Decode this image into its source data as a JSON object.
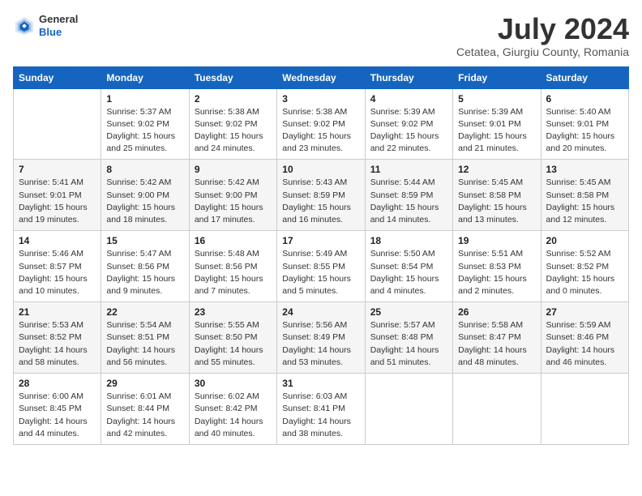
{
  "header": {
    "logo_general": "General",
    "logo_blue": "Blue",
    "month_year": "July 2024",
    "location": "Cetatea, Giurgiu County, Romania"
  },
  "calendar": {
    "weekdays": [
      "Sunday",
      "Monday",
      "Tuesday",
      "Wednesday",
      "Thursday",
      "Friday",
      "Saturday"
    ],
    "weeks": [
      [
        {
          "day": "",
          "info": ""
        },
        {
          "day": "1",
          "info": "Sunrise: 5:37 AM\nSunset: 9:02 PM\nDaylight: 15 hours\nand 25 minutes."
        },
        {
          "day": "2",
          "info": "Sunrise: 5:38 AM\nSunset: 9:02 PM\nDaylight: 15 hours\nand 24 minutes."
        },
        {
          "day": "3",
          "info": "Sunrise: 5:38 AM\nSunset: 9:02 PM\nDaylight: 15 hours\nand 23 minutes."
        },
        {
          "day": "4",
          "info": "Sunrise: 5:39 AM\nSunset: 9:02 PM\nDaylight: 15 hours\nand 22 minutes."
        },
        {
          "day": "5",
          "info": "Sunrise: 5:39 AM\nSunset: 9:01 PM\nDaylight: 15 hours\nand 21 minutes."
        },
        {
          "day": "6",
          "info": "Sunrise: 5:40 AM\nSunset: 9:01 PM\nDaylight: 15 hours\nand 20 minutes."
        }
      ],
      [
        {
          "day": "7",
          "info": "Sunrise: 5:41 AM\nSunset: 9:01 PM\nDaylight: 15 hours\nand 19 minutes."
        },
        {
          "day": "8",
          "info": "Sunrise: 5:42 AM\nSunset: 9:00 PM\nDaylight: 15 hours\nand 18 minutes."
        },
        {
          "day": "9",
          "info": "Sunrise: 5:42 AM\nSunset: 9:00 PM\nDaylight: 15 hours\nand 17 minutes."
        },
        {
          "day": "10",
          "info": "Sunrise: 5:43 AM\nSunset: 8:59 PM\nDaylight: 15 hours\nand 16 minutes."
        },
        {
          "day": "11",
          "info": "Sunrise: 5:44 AM\nSunset: 8:59 PM\nDaylight: 15 hours\nand 14 minutes."
        },
        {
          "day": "12",
          "info": "Sunrise: 5:45 AM\nSunset: 8:58 PM\nDaylight: 15 hours\nand 13 minutes."
        },
        {
          "day": "13",
          "info": "Sunrise: 5:45 AM\nSunset: 8:58 PM\nDaylight: 15 hours\nand 12 minutes."
        }
      ],
      [
        {
          "day": "14",
          "info": "Sunrise: 5:46 AM\nSunset: 8:57 PM\nDaylight: 15 hours\nand 10 minutes."
        },
        {
          "day": "15",
          "info": "Sunrise: 5:47 AM\nSunset: 8:56 PM\nDaylight: 15 hours\nand 9 minutes."
        },
        {
          "day": "16",
          "info": "Sunrise: 5:48 AM\nSunset: 8:56 PM\nDaylight: 15 hours\nand 7 minutes."
        },
        {
          "day": "17",
          "info": "Sunrise: 5:49 AM\nSunset: 8:55 PM\nDaylight: 15 hours\nand 5 minutes."
        },
        {
          "day": "18",
          "info": "Sunrise: 5:50 AM\nSunset: 8:54 PM\nDaylight: 15 hours\nand 4 minutes."
        },
        {
          "day": "19",
          "info": "Sunrise: 5:51 AM\nSunset: 8:53 PM\nDaylight: 15 hours\nand 2 minutes."
        },
        {
          "day": "20",
          "info": "Sunrise: 5:52 AM\nSunset: 8:52 PM\nDaylight: 15 hours\nand 0 minutes."
        }
      ],
      [
        {
          "day": "21",
          "info": "Sunrise: 5:53 AM\nSunset: 8:52 PM\nDaylight: 14 hours\nand 58 minutes."
        },
        {
          "day": "22",
          "info": "Sunrise: 5:54 AM\nSunset: 8:51 PM\nDaylight: 14 hours\nand 56 minutes."
        },
        {
          "day": "23",
          "info": "Sunrise: 5:55 AM\nSunset: 8:50 PM\nDaylight: 14 hours\nand 55 minutes."
        },
        {
          "day": "24",
          "info": "Sunrise: 5:56 AM\nSunset: 8:49 PM\nDaylight: 14 hours\nand 53 minutes."
        },
        {
          "day": "25",
          "info": "Sunrise: 5:57 AM\nSunset: 8:48 PM\nDaylight: 14 hours\nand 51 minutes."
        },
        {
          "day": "26",
          "info": "Sunrise: 5:58 AM\nSunset: 8:47 PM\nDaylight: 14 hours\nand 48 minutes."
        },
        {
          "day": "27",
          "info": "Sunrise: 5:59 AM\nSunset: 8:46 PM\nDaylight: 14 hours\nand 46 minutes."
        }
      ],
      [
        {
          "day": "28",
          "info": "Sunrise: 6:00 AM\nSunset: 8:45 PM\nDaylight: 14 hours\nand 44 minutes."
        },
        {
          "day": "29",
          "info": "Sunrise: 6:01 AM\nSunset: 8:44 PM\nDaylight: 14 hours\nand 42 minutes."
        },
        {
          "day": "30",
          "info": "Sunrise: 6:02 AM\nSunset: 8:42 PM\nDaylight: 14 hours\nand 40 minutes."
        },
        {
          "day": "31",
          "info": "Sunrise: 6:03 AM\nSunset: 8:41 PM\nDaylight: 14 hours\nand 38 minutes."
        },
        {
          "day": "",
          "info": ""
        },
        {
          "day": "",
          "info": ""
        },
        {
          "day": "",
          "info": ""
        }
      ]
    ]
  }
}
